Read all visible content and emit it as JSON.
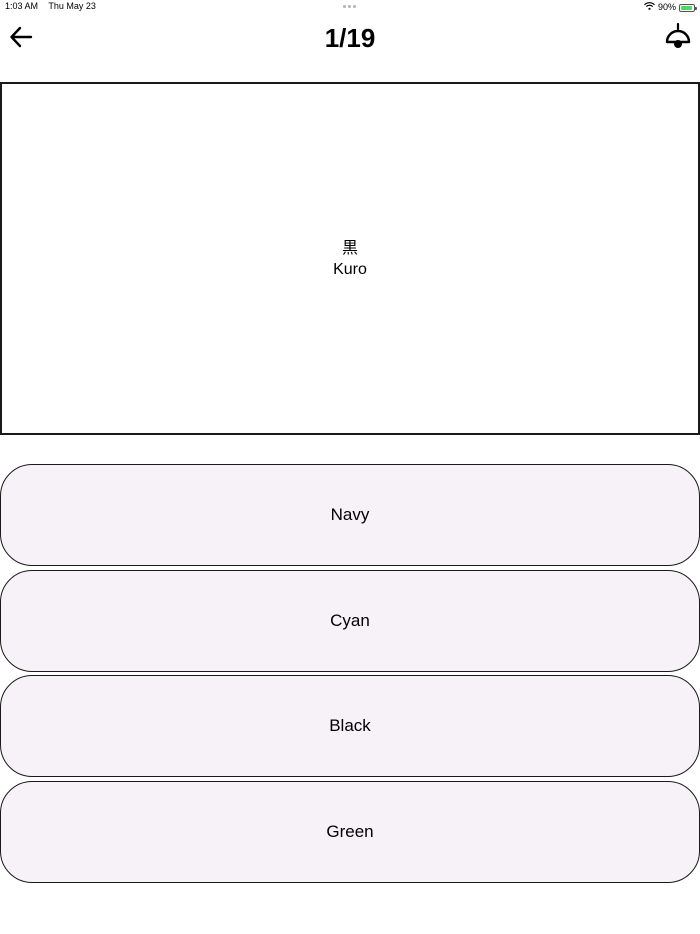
{
  "status_bar": {
    "time": "1:03 AM",
    "date": "Thu May 23",
    "battery": "90%",
    "battery_level": 0.9
  },
  "header": {
    "title": "1/19"
  },
  "prompt": {
    "kanji": "黒",
    "reading": "Kuro"
  },
  "answers": [
    {
      "label": "Navy"
    },
    {
      "label": "Cyan"
    },
    {
      "label": "Black"
    },
    {
      "label": "Green"
    }
  ],
  "colors": {
    "answer_background": "#f7f2f7",
    "border": "#1a1a1a"
  }
}
